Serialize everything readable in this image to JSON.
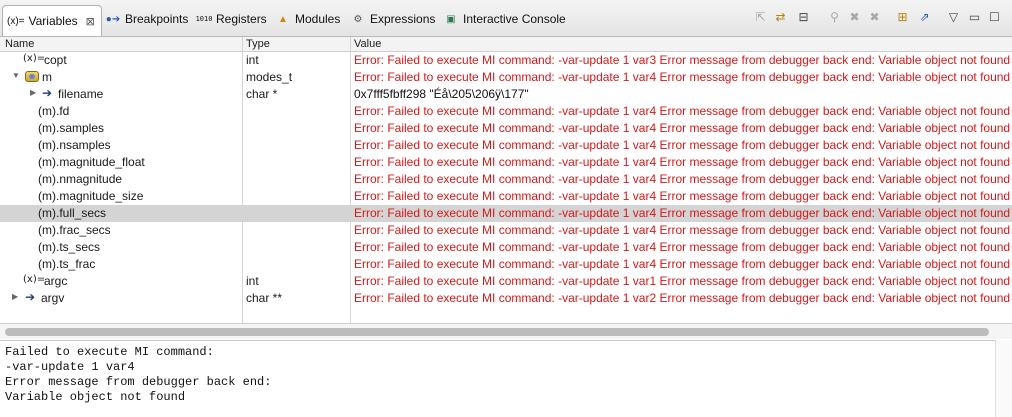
{
  "tabs": [
    {
      "icon": "variables-icon",
      "glyph": "(x)=",
      "label": "Variables",
      "active": true
    },
    {
      "icon": "breakpoints-icon",
      "glyph": "●➔",
      "label": "Breakpoints"
    },
    {
      "icon": "registers-icon",
      "glyph": "1010",
      "label": "Registers"
    },
    {
      "icon": "modules-icon",
      "glyph": "▲",
      "label": "Modules"
    },
    {
      "icon": "expressions-icon",
      "glyph": "⚙",
      "label": "Expressions"
    },
    {
      "icon": "interactive-console-icon",
      "glyph": "▣",
      "label": "Interactive Console"
    }
  ],
  "columns": {
    "name": "Name",
    "type": "Type",
    "value": "Value"
  },
  "rows": [
    {
      "name": "copt",
      "type": "int",
      "value": "Error: Failed to execute MI command: -var-update 1 var3 Error message from debugger back end: Variable object not found",
      "level": 0,
      "icon": "variable",
      "expander": ""
    },
    {
      "name": "m",
      "type": "modes_t",
      "value": "Error: Failed to execute MI command: -var-update 1 var4 Error message from debugger back end: Variable object not found",
      "level": 0,
      "icon": "struct",
      "expander": "open"
    },
    {
      "name": "filename",
      "type": "char *",
      "value": "0x7fff5fbff298 \"Éå\\205\\206ÿ\\177\"",
      "level": 1,
      "icon": "pointer",
      "expander": "closed",
      "ok": true
    },
    {
      "name": "(m).fd",
      "type": "",
      "value": "Error: Failed to execute MI command: -var-update 1 var4 Error message from debugger back end: Variable object not found",
      "level": 1,
      "icon": "",
      "expander": ""
    },
    {
      "name": "(m).samples",
      "type": "",
      "value": "Error: Failed to execute MI command: -var-update 1 var4 Error message from debugger back end: Variable object not found",
      "level": 1,
      "icon": "",
      "expander": ""
    },
    {
      "name": "(m).nsamples",
      "type": "",
      "value": "Error: Failed to execute MI command: -var-update 1 var4 Error message from debugger back end: Variable object not found",
      "level": 1,
      "icon": "",
      "expander": ""
    },
    {
      "name": "(m).magnitude_float",
      "type": "",
      "value": "Error: Failed to execute MI command: -var-update 1 var4 Error message from debugger back end: Variable object not found",
      "level": 1,
      "icon": "",
      "expander": ""
    },
    {
      "name": "(m).nmagnitude",
      "type": "",
      "value": "Error: Failed to execute MI command: -var-update 1 var4 Error message from debugger back end: Variable object not found",
      "level": 1,
      "icon": "",
      "expander": ""
    },
    {
      "name": "(m).magnitude_size",
      "type": "",
      "value": "Error: Failed to execute MI command: -var-update 1 var4 Error message from debugger back end: Variable object not found",
      "level": 1,
      "icon": "",
      "expander": ""
    },
    {
      "name": "(m).full_secs",
      "type": "",
      "value": "Error: Failed to execute MI command: -var-update 1 var4 Error message from debugger back end: Variable object not found",
      "level": 1,
      "icon": "",
      "expander": "",
      "selected": true
    },
    {
      "name": "(m).frac_secs",
      "type": "",
      "value": "Error: Failed to execute MI command: -var-update 1 var4 Error message from debugger back end: Variable object not found",
      "level": 1,
      "icon": "",
      "expander": ""
    },
    {
      "name": "(m).ts_secs",
      "type": "",
      "value": "Error: Failed to execute MI command: -var-update 1 var4 Error message from debugger back end: Variable object not found",
      "level": 1,
      "icon": "",
      "expander": ""
    },
    {
      "name": "(m).ts_frac",
      "type": "",
      "value": "Error: Failed to execute MI command: -var-update 1 var4 Error message from debugger back end: Variable object not found",
      "level": 1,
      "icon": "",
      "expander": ""
    },
    {
      "name": "argc",
      "type": "int",
      "value": "Error: Failed to execute MI command: -var-update 1 var1 Error message from debugger back end: Variable object not found",
      "level": 0,
      "icon": "variable",
      "expander": ""
    },
    {
      "name": "argv",
      "type": "char **",
      "value": "Error: Failed to execute MI command: -var-update 1 var2 Error message from debugger back end: Variable object not found",
      "level": 0,
      "icon": "pointer",
      "expander": "closed"
    }
  ],
  "detail": [
    "Failed to execute MI command:",
    "-var-update 1 var4",
    "Error message from debugger back end:",
    "Variable object not found"
  ],
  "toolbar": [
    {
      "icon": "show-type-names-icon",
      "glyph": "⇱",
      "enabled": false
    },
    {
      "icon": "show-logical-structure-icon",
      "glyph": "⇄",
      "enabled": true
    },
    {
      "icon": "collapse-all-icon",
      "glyph": "⊟",
      "enabled": true
    },
    {
      "icon": "add-watch-icon",
      "glyph": "⚲",
      "enabled": false
    },
    {
      "icon": "remove-icon",
      "glyph": "✖",
      "enabled": false
    },
    {
      "icon": "remove-all-icon",
      "glyph": "✖",
      "enabled": false
    },
    {
      "icon": "new-view-icon",
      "glyph": "⊞",
      "enabled": true
    },
    {
      "icon": "pin-icon",
      "glyph": "⇗",
      "enabled": true
    },
    {
      "icon": "view-menu-icon",
      "glyph": "▽",
      "enabled": true
    },
    {
      "icon": "minimize-icon",
      "glyph": "▭",
      "enabled": true
    },
    {
      "icon": "maximize-icon",
      "glyph": "☐",
      "enabled": true
    }
  ],
  "colors": {
    "error": "#d61818",
    "selected_row": "#d4d4d4"
  }
}
